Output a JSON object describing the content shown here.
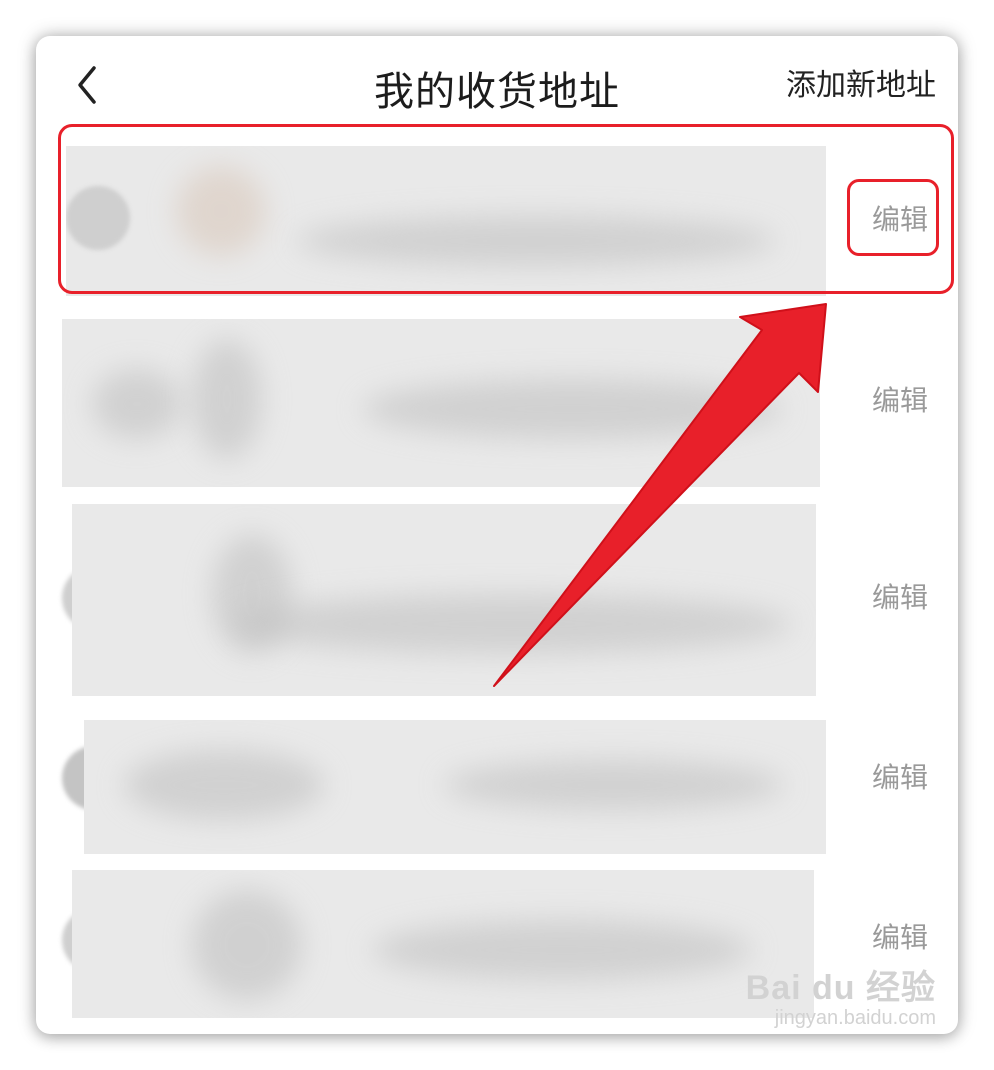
{
  "header": {
    "title": "我的收货地址",
    "add_label": "添加新地址"
  },
  "addresses": [
    {
      "edit_label": "编辑"
    },
    {
      "edit_label": "编辑"
    },
    {
      "edit_label": "编辑"
    },
    {
      "edit_label": "编辑"
    },
    {
      "edit_label": "编辑"
    }
  ],
  "annotation_color": "#e8202a",
  "watermark": {
    "logo": "Bai du 经验",
    "url": "jingyan.baidu.com"
  }
}
